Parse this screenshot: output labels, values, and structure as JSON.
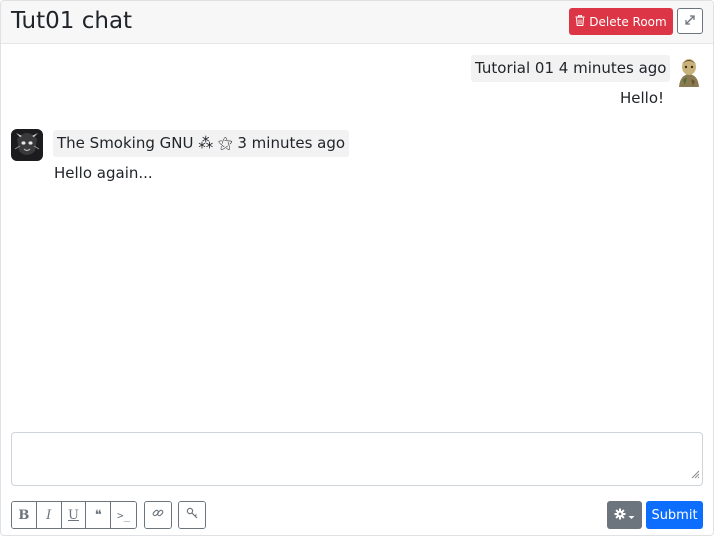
{
  "header": {
    "title": "Tut01 chat",
    "delete_label": "Delete Room"
  },
  "messages": [
    {
      "author": "Tutorial 01",
      "time": "4 minutes ago",
      "text": "Hello!",
      "side": "right"
    },
    {
      "author": "The Smoking GNU",
      "badges": "⁂ ⚝",
      "time": "3 minutes ago",
      "text": "Hello again...",
      "side": "left"
    }
  ],
  "composer": {
    "placeholder": "",
    "submit_label": "Submit",
    "format_buttons": {
      "bold": "B",
      "italic": "I",
      "underline": "U",
      "quote": "❝",
      "code": ">_"
    }
  },
  "colors": {
    "danger": "#dc3545",
    "primary": "#0d6efd",
    "secondary": "#6c757d"
  }
}
